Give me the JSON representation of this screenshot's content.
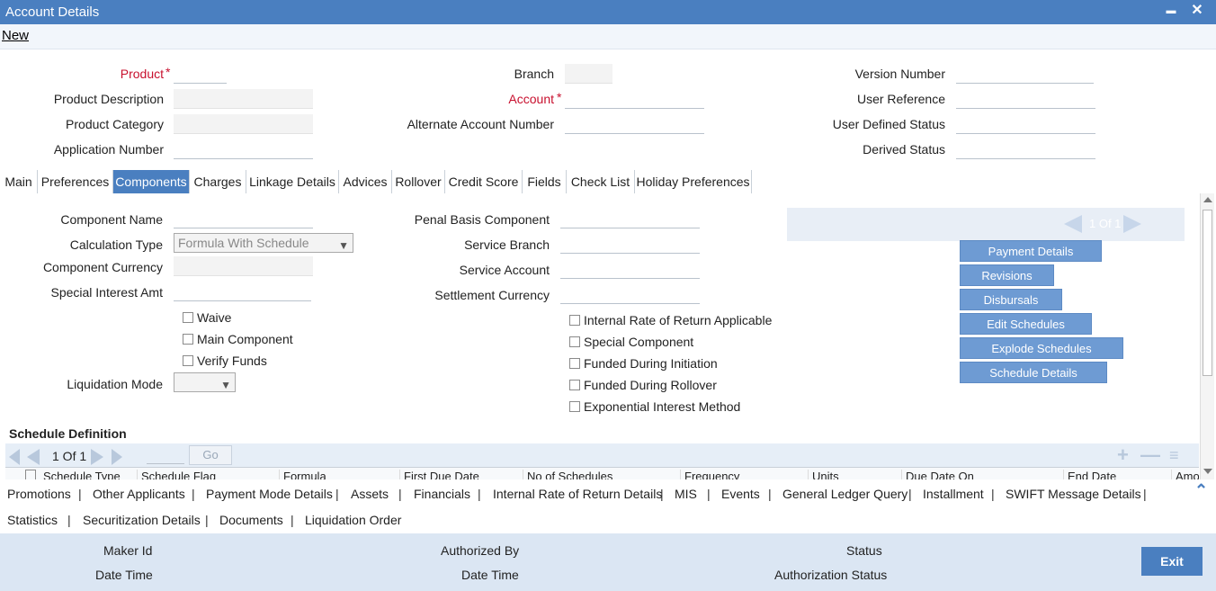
{
  "window": {
    "title": "Account Details",
    "minimize_glyph": "▬",
    "close_glyph": "✕"
  },
  "menu": {
    "new_label": "New"
  },
  "header": {
    "product": "Product",
    "product_description": "Product Description",
    "product_category": "Product Category",
    "application_number": "Application Number",
    "branch": "Branch",
    "account": "Account",
    "alternate_account_number": "Alternate Account Number",
    "version_number": "Version Number",
    "user_reference": "User Reference",
    "user_defined_status": "User Defined Status",
    "derived_status": "Derived Status",
    "required_mark": "*"
  },
  "tabs": [
    "Main",
    "Preferences",
    "Components",
    "Charges",
    "Linkage Details",
    "Advices",
    "Rollover",
    "Credit Score",
    "Fields",
    "Check List",
    "Holiday Preferences"
  ],
  "active_tab": "Components",
  "components": {
    "component_name": "Component Name",
    "calculation_type": "Calculation Type",
    "calculation_type_value": "Formula With Schedule",
    "component_currency": "Component Currency",
    "special_interest_amt": "Special Interest Amt",
    "waive": "Waive",
    "main_component": "Main Component",
    "verify_funds": "Verify Funds",
    "liquidation_mode": "Liquidation Mode",
    "penal_basis_component": "Penal Basis Component",
    "service_branch": "Service Branch",
    "service_account": "Service Account",
    "settlement_currency": "Settlement Currency",
    "irr_applicable": "Internal Rate of Return Applicable",
    "special_component": "Special Component",
    "funded_during_initiation": "Funded During Initiation",
    "funded_during_rollover": "Funded During Rollover",
    "exponential_interest_method": "Exponential Interest Method"
  },
  "record_pager": {
    "text": "1 Of 1"
  },
  "side_buttons": [
    "Payment Details",
    "Revisions",
    "Disbursals",
    "Edit Schedules",
    "Explode Schedules",
    "Schedule Details"
  ],
  "schedule": {
    "title": "Schedule Definition",
    "pager_text": "1 Of 1",
    "go_label": "Go",
    "columns": [
      "Schedule Type",
      "Schedule Flag",
      "Formula",
      "First Due Date",
      "No of Schedules",
      "Frequency",
      "Units",
      "Due Date On",
      "End Date",
      "Amo"
    ]
  },
  "bottom_links_row1": [
    "Promotions",
    "Other Applicants",
    "Payment Mode Details",
    "Assets",
    "Financials",
    "Internal Rate of Return Details",
    "MIS",
    "Events",
    "General Ledger Query",
    "Installment",
    "SWIFT Message Details"
  ],
  "bottom_links_row2": [
    "Statistics",
    "Securitization Details",
    "Documents",
    "Liquidation Order"
  ],
  "footer": {
    "maker_id": "Maker Id",
    "date_time_1": "Date Time",
    "authorized_by": "Authorized By",
    "date_time_2": "Date Time",
    "status": "Status",
    "authorization_status": "Authorization Status",
    "exit_label": "Exit"
  },
  "colors": {
    "accent": "#4a7fc0",
    "required": "#c8102e",
    "button": "#6e9bd3",
    "footer_bg": "#dbe6f3"
  }
}
